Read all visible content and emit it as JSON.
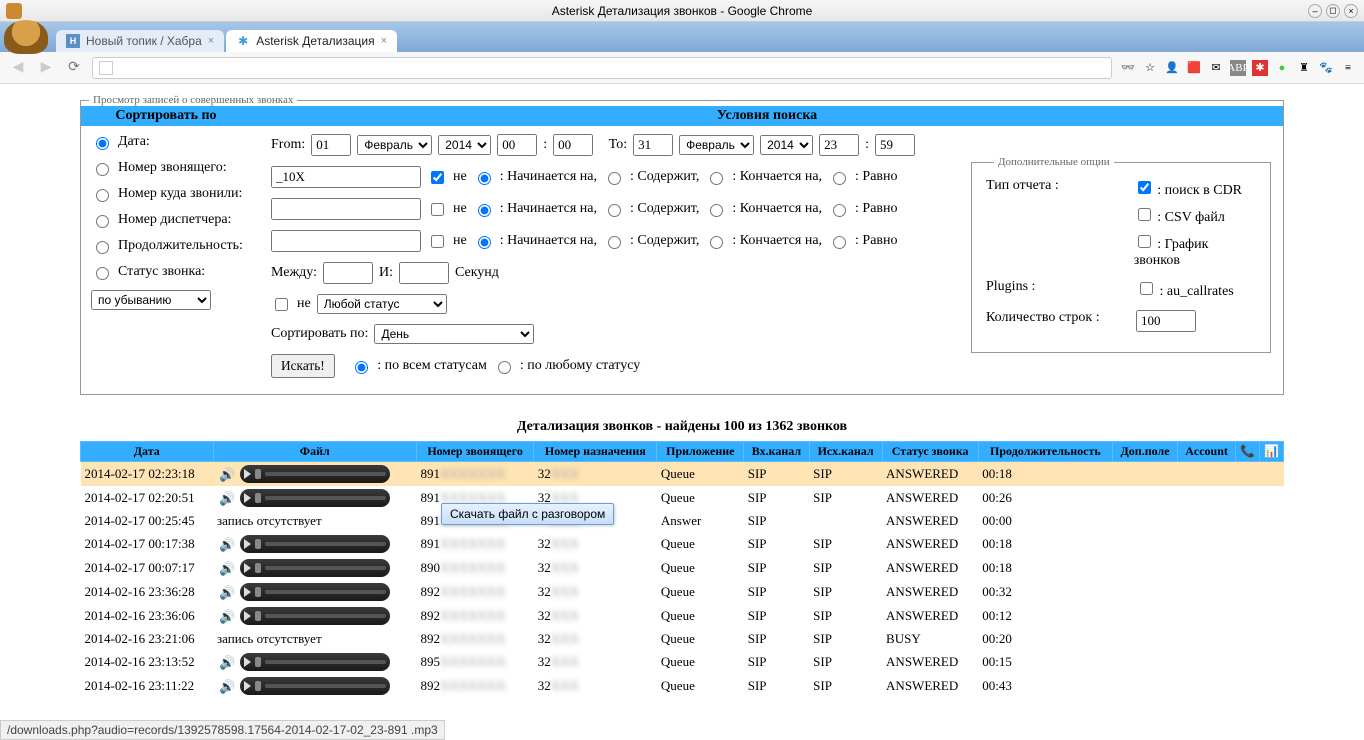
{
  "window": {
    "title": "Asterisk Детализация звонков - Google Chrome"
  },
  "tabs": {
    "inactive_label": "Новый топик / Хабра",
    "active_label": "Asterisk Детализация"
  },
  "legend": "Просмотр записей о совершенных звонках",
  "header": {
    "sort_by": "Сортировать по",
    "search_conditions": "Условия поиска"
  },
  "sort_options": {
    "date": "Дата:",
    "caller": "Номер звонящего:",
    "callee": "Номер куда звонили:",
    "dispatcher": "Номер диспетчера:",
    "duration": "Продолжительность:",
    "status": "Статус звонка:",
    "order_select": "по убыванию"
  },
  "date_row": {
    "from": "From:",
    "from_day": "01",
    "from_month": "Февраль",
    "from_year": "2014",
    "from_h": "00",
    "from_m": "00",
    "to": "To:",
    "to_day": "31",
    "to_month": "Февраль",
    "to_year": "2014",
    "to_h": "23",
    "to_m": "59"
  },
  "caller_row": {
    "value": "_10X",
    "not": "не",
    "starts": ": Начинается на,",
    "contains": ": Содержит,",
    "ends": ": Кончается на,",
    "equals": ": Равно"
  },
  "generic_row": {
    "not": "не",
    "starts": ": Начинается на,",
    "contains": ": Содержит,",
    "ends": ": Кончается на,",
    "equals": ": Равно"
  },
  "duration_row": {
    "between": "Между:",
    "and": "И:",
    "seconds": "Секунд"
  },
  "status_row": {
    "not": "не",
    "any_status": "Любой статус"
  },
  "bottom_row": {
    "sort_by": "Сортировать по:",
    "day": "День"
  },
  "search_row": {
    "button": "Искать!",
    "all_statuses": ": по всем статусам",
    "any_status": ": по любому статусу"
  },
  "extras": {
    "legend": "Дополнительные опции",
    "report_type": "Тип отчета :",
    "cdr": ": поиск в CDR",
    "csv": ": CSV файл",
    "chart": ": График звонков",
    "plugins": "Plugins :",
    "au_callrates": ": au_callrates",
    "rows": "Количество строк :",
    "rows_value": "100"
  },
  "results_title": "Детализация звонков - найдены 100 из 1362 звонков",
  "columns": [
    "Дата",
    "Файл",
    "Номер звонящего",
    "Номер назначения",
    "Приложение",
    "Вх.канал",
    "Исх.канал",
    "Статус звонка",
    "Продолжительность",
    "Доп.поле",
    "Account"
  ],
  "tooltip": "Скачать файл с разговором",
  "no_record": "запись отсутствует",
  "rows": [
    {
      "date": "2014-02-17 02:23:18",
      "file": "player",
      "src": "891",
      "dst": "32",
      "app": "Queue",
      "inch": "SIP",
      "outch": "SIP",
      "status": "ANSWERED",
      "dur": "00:18",
      "highlight": true
    },
    {
      "date": "2014-02-17 02:20:51",
      "file": "player",
      "src": "891",
      "dst": "32",
      "app": "Queue",
      "inch": "SIP",
      "outch": "SIP",
      "status": "ANSWERED",
      "dur": "00:26",
      "tooltip": true
    },
    {
      "date": "2014-02-17 00:25:45",
      "file": "none",
      "src": "891",
      "dst": "32",
      "app": "Answer",
      "inch": "SIP",
      "outch": "",
      "status": "ANSWERED",
      "dur": "00:00"
    },
    {
      "date": "2014-02-17 00:17:38",
      "file": "player",
      "src": "891",
      "dst": "32",
      "app": "Queue",
      "inch": "SIP",
      "outch": "SIP",
      "status": "ANSWERED",
      "dur": "00:18"
    },
    {
      "date": "2014-02-17 00:07:17",
      "file": "player",
      "src": "890",
      "dst": "32",
      "app": "Queue",
      "inch": "SIP",
      "outch": "SIP",
      "status": "ANSWERED",
      "dur": "00:18"
    },
    {
      "date": "2014-02-16 23:36:28",
      "file": "player",
      "src": "892",
      "dst": "32",
      "app": "Queue",
      "inch": "SIP",
      "outch": "SIP",
      "status": "ANSWERED",
      "dur": "00:32"
    },
    {
      "date": "2014-02-16 23:36:06",
      "file": "player",
      "src": "892",
      "dst": "32",
      "app": "Queue",
      "inch": "SIP",
      "outch": "SIP",
      "status": "ANSWERED",
      "dur": "00:12"
    },
    {
      "date": "2014-02-16 23:21:06",
      "file": "none",
      "src": "892",
      "dst": "32",
      "app": "Queue",
      "inch": "SIP",
      "outch": "SIP",
      "status": "BUSY",
      "dur": "00:20"
    },
    {
      "date": "2014-02-16 23:13:52",
      "file": "player",
      "src": "895",
      "dst": "32",
      "app": "Queue",
      "inch": "SIP",
      "outch": "SIP",
      "status": "ANSWERED",
      "dur": "00:15"
    },
    {
      "date": "2014-02-16 23:11:22",
      "file": "player",
      "src": "892",
      "dst": "32",
      "app": "Queue",
      "inch": "SIP",
      "outch": "SIP",
      "status": "ANSWERED",
      "dur": "00:43"
    }
  ],
  "status_bar": "/downloads.php?audio=records/1392578598.17564-2014-02-17-02_23-891                           .mp3"
}
